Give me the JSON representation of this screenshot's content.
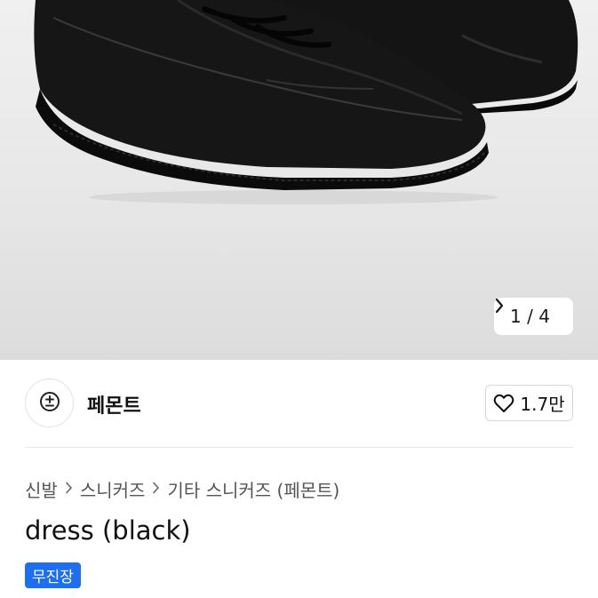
{
  "gallery": {
    "current_page": 1,
    "total_pages": 4,
    "counter_label": "1 / 4",
    "next_icon": "chevron-right-icon"
  },
  "shop": {
    "name": "페몬트",
    "avatar_icon": "plus-minus-logo-icon",
    "likes_label": "1.7만",
    "like_icon": "heart-outline-icon"
  },
  "breadcrumb": {
    "items": [
      "신발",
      "스니커즈",
      "기타 스니커즈 (페몬트)"
    ],
    "separator_icon": "chevron-right-icon"
  },
  "product": {
    "title": "dress (black)",
    "badge": "무진장"
  },
  "colors": {
    "badge_bg": "#1e6ff0",
    "hero_bg": "#e7e7e7"
  }
}
